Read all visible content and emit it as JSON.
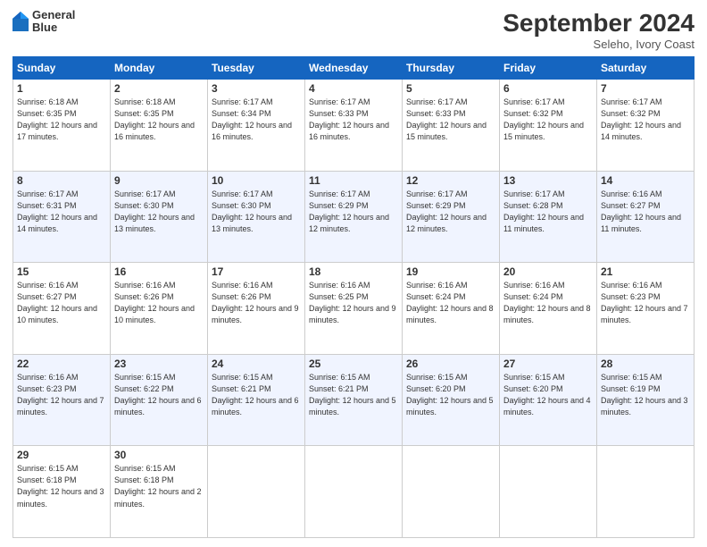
{
  "logo": {
    "line1": "General",
    "line2": "Blue"
  },
  "title": "September 2024",
  "subtitle": "Seleho, Ivory Coast",
  "days_header": [
    "Sunday",
    "Monday",
    "Tuesday",
    "Wednesday",
    "Thursday",
    "Friday",
    "Saturday"
  ],
  "weeks": [
    [
      {
        "num": "1",
        "sunrise": "6:18 AM",
        "sunset": "6:35 PM",
        "daylight": "12 hours and 17 minutes."
      },
      {
        "num": "2",
        "sunrise": "6:18 AM",
        "sunset": "6:35 PM",
        "daylight": "12 hours and 16 minutes."
      },
      {
        "num": "3",
        "sunrise": "6:17 AM",
        "sunset": "6:34 PM",
        "daylight": "12 hours and 16 minutes."
      },
      {
        "num": "4",
        "sunrise": "6:17 AM",
        "sunset": "6:33 PM",
        "daylight": "12 hours and 16 minutes."
      },
      {
        "num": "5",
        "sunrise": "6:17 AM",
        "sunset": "6:33 PM",
        "daylight": "12 hours and 15 minutes."
      },
      {
        "num": "6",
        "sunrise": "6:17 AM",
        "sunset": "6:32 PM",
        "daylight": "12 hours and 15 minutes."
      },
      {
        "num": "7",
        "sunrise": "6:17 AM",
        "sunset": "6:32 PM",
        "daylight": "12 hours and 14 minutes."
      }
    ],
    [
      {
        "num": "8",
        "sunrise": "6:17 AM",
        "sunset": "6:31 PM",
        "daylight": "12 hours and 14 minutes."
      },
      {
        "num": "9",
        "sunrise": "6:17 AM",
        "sunset": "6:30 PM",
        "daylight": "12 hours and 13 minutes."
      },
      {
        "num": "10",
        "sunrise": "6:17 AM",
        "sunset": "6:30 PM",
        "daylight": "12 hours and 13 minutes."
      },
      {
        "num": "11",
        "sunrise": "6:17 AM",
        "sunset": "6:29 PM",
        "daylight": "12 hours and 12 minutes."
      },
      {
        "num": "12",
        "sunrise": "6:17 AM",
        "sunset": "6:29 PM",
        "daylight": "12 hours and 12 minutes."
      },
      {
        "num": "13",
        "sunrise": "6:17 AM",
        "sunset": "6:28 PM",
        "daylight": "12 hours and 11 minutes."
      },
      {
        "num": "14",
        "sunrise": "6:16 AM",
        "sunset": "6:27 PM",
        "daylight": "12 hours and 11 minutes."
      }
    ],
    [
      {
        "num": "15",
        "sunrise": "6:16 AM",
        "sunset": "6:27 PM",
        "daylight": "12 hours and 10 minutes."
      },
      {
        "num": "16",
        "sunrise": "6:16 AM",
        "sunset": "6:26 PM",
        "daylight": "12 hours and 10 minutes."
      },
      {
        "num": "17",
        "sunrise": "6:16 AM",
        "sunset": "6:26 PM",
        "daylight": "12 hours and 9 minutes."
      },
      {
        "num": "18",
        "sunrise": "6:16 AM",
        "sunset": "6:25 PM",
        "daylight": "12 hours and 9 minutes."
      },
      {
        "num": "19",
        "sunrise": "6:16 AM",
        "sunset": "6:24 PM",
        "daylight": "12 hours and 8 minutes."
      },
      {
        "num": "20",
        "sunrise": "6:16 AM",
        "sunset": "6:24 PM",
        "daylight": "12 hours and 8 minutes."
      },
      {
        "num": "21",
        "sunrise": "6:16 AM",
        "sunset": "6:23 PM",
        "daylight": "12 hours and 7 minutes."
      }
    ],
    [
      {
        "num": "22",
        "sunrise": "6:16 AM",
        "sunset": "6:23 PM",
        "daylight": "12 hours and 7 minutes."
      },
      {
        "num": "23",
        "sunrise": "6:15 AM",
        "sunset": "6:22 PM",
        "daylight": "12 hours and 6 minutes."
      },
      {
        "num": "24",
        "sunrise": "6:15 AM",
        "sunset": "6:21 PM",
        "daylight": "12 hours and 6 minutes."
      },
      {
        "num": "25",
        "sunrise": "6:15 AM",
        "sunset": "6:21 PM",
        "daylight": "12 hours and 5 minutes."
      },
      {
        "num": "26",
        "sunrise": "6:15 AM",
        "sunset": "6:20 PM",
        "daylight": "12 hours and 5 minutes."
      },
      {
        "num": "27",
        "sunrise": "6:15 AM",
        "sunset": "6:20 PM",
        "daylight": "12 hours and 4 minutes."
      },
      {
        "num": "28",
        "sunrise": "6:15 AM",
        "sunset": "6:19 PM",
        "daylight": "12 hours and 3 minutes."
      }
    ],
    [
      {
        "num": "29",
        "sunrise": "6:15 AM",
        "sunset": "6:18 PM",
        "daylight": "12 hours and 3 minutes."
      },
      {
        "num": "30",
        "sunrise": "6:15 AM",
        "sunset": "6:18 PM",
        "daylight": "12 hours and 2 minutes."
      },
      null,
      null,
      null,
      null,
      null
    ]
  ]
}
